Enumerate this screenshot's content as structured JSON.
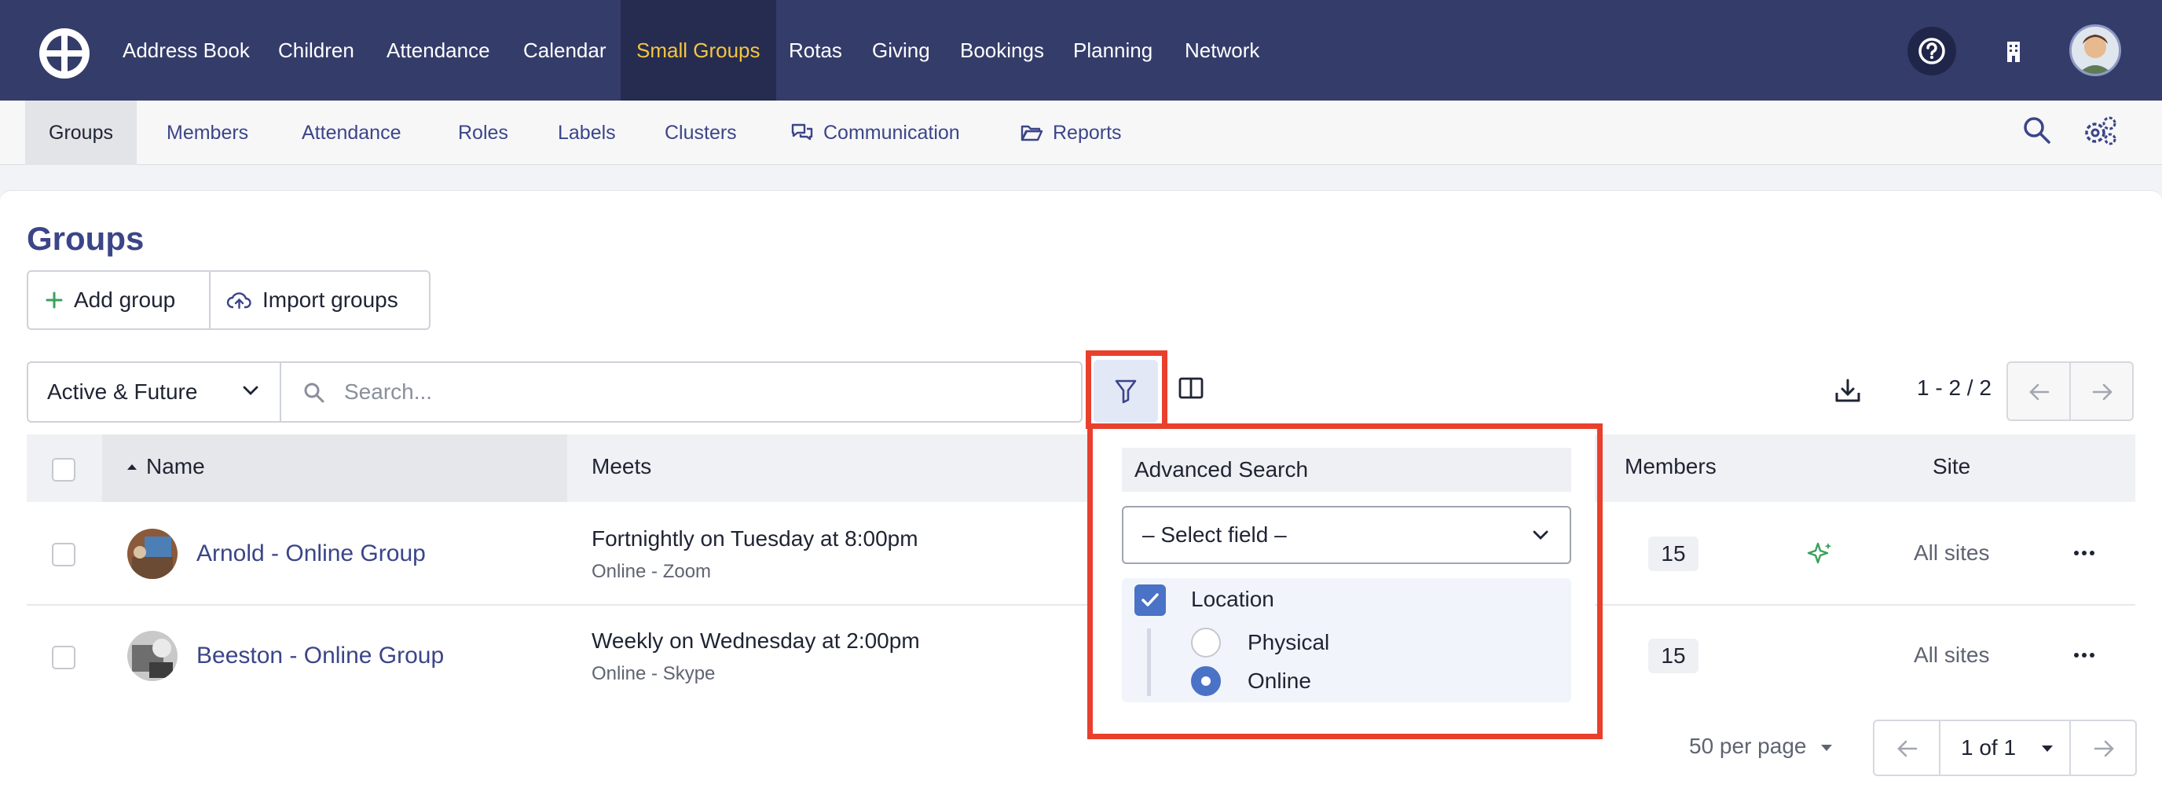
{
  "topnav": {
    "items": [
      "Address Book",
      "Children",
      "Attendance",
      "Calendar",
      "Small Groups",
      "Rotas",
      "Giving",
      "Bookings",
      "Planning",
      "Network"
    ],
    "active": "Small Groups",
    "icons": [
      "help-circle-icon",
      "building-icon",
      "user-avatar"
    ]
  },
  "subnav": {
    "items": [
      "Groups",
      "Members",
      "Attendance",
      "Roles",
      "Labels",
      "Clusters",
      "Communication",
      "Reports"
    ],
    "active": "Groups"
  },
  "page": {
    "title": "Groups",
    "add_group": "Add group",
    "import_groups": "Import groups"
  },
  "toolbar": {
    "status_select": "Active & Future",
    "search_placeholder": "Search...",
    "range": "1 - 2 / 2"
  },
  "table": {
    "headers": {
      "name": "Name",
      "meets": "Meets",
      "members": "Members",
      "site": "Site"
    },
    "rows": [
      {
        "name": "Arnold - Online Group",
        "meets": "Fortnightly on Tuesday at 8:00pm",
        "meets_sub": "Online - Zoom",
        "members": "15",
        "site": "All sites"
      },
      {
        "name": "Beeston - Online Group",
        "meets": "Weekly on Wednesday at 2:00pm",
        "meets_sub": "Online - Skype",
        "members": "15",
        "site": "All sites"
      }
    ]
  },
  "pagination": {
    "per_page": "50 per page",
    "current": "1 of 1"
  },
  "advanced_search": {
    "title": "Advanced Search",
    "select_placeholder": "– Select field –",
    "location_label": "Location",
    "location_checked": true,
    "options": [
      "Physical",
      "Online"
    ],
    "selected_option": "Online"
  },
  "colors": {
    "topnav_bg": "#343c6a",
    "active_tab_text": "#f4c542",
    "link": "#3b4588",
    "highlight": "#e8402d",
    "checkbox_on": "#4a72c6"
  }
}
